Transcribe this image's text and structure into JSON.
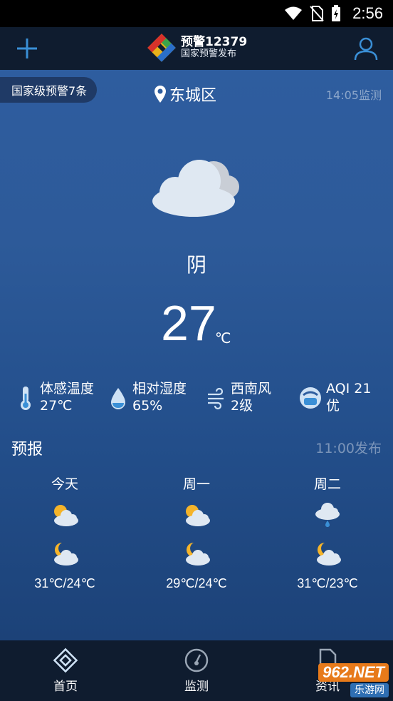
{
  "status_bar": {
    "time": "2:56"
  },
  "app_bar": {
    "logo_title": "预警12379",
    "logo_subtitle": "国家预警发布"
  },
  "current": {
    "warning_badge": "国家级预警7条",
    "location": "东城区",
    "monitor_time": "14:05监测",
    "condition": "阴",
    "temperature": "27",
    "temperature_unit": "℃",
    "condition_icon": "cloudy-icon"
  },
  "metrics": [
    {
      "label": "体感温度",
      "value": "27℃",
      "icon": "thermometer-icon"
    },
    {
      "label": "相对湿度",
      "value": "65%",
      "icon": "humidity-drop-icon"
    },
    {
      "label": "西南风",
      "value": "2级",
      "icon": "wind-icon"
    },
    {
      "label": "AQI 21",
      "value": "优",
      "icon": "air-quality-mask-icon"
    }
  ],
  "forecast": {
    "title": "预报",
    "published": "11:00发布",
    "days": [
      {
        "name": "今天",
        "day_icon": "partly-cloudy-day-icon",
        "night_icon": "partly-cloudy-night-icon",
        "range": "31℃/24℃"
      },
      {
        "name": "周一",
        "day_icon": "partly-cloudy-day-icon",
        "night_icon": "partly-cloudy-night-icon",
        "range": "29℃/24℃"
      },
      {
        "name": "周二",
        "day_icon": "light-rain-icon",
        "night_icon": "partly-cloudy-night-icon",
        "range": "31℃/23℃"
      }
    ]
  },
  "bottom_nav": [
    {
      "label": "首页",
      "icon": "home-logo-icon"
    },
    {
      "label": "监测",
      "icon": "gauge-icon"
    },
    {
      "label": "资讯",
      "icon": "document-icon"
    }
  ],
  "watermark": {
    "top": "962.NET",
    "bottom": "乐游网"
  },
  "colors": {
    "sky_top": "#2e5d9f",
    "sky_bottom": "#1c4278",
    "bar": "#0f1c2f"
  }
}
